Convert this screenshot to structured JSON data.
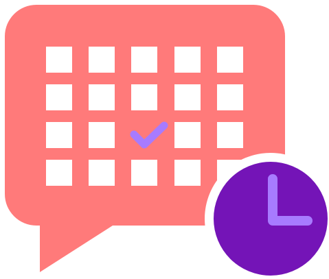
{
  "icon": {
    "name": "calendar-schedule-icon",
    "rows": 4,
    "columns": 5,
    "checked_cell": {
      "row": 3,
      "column": 3
    },
    "colors": {
      "bubble": "#FF7A7A",
      "cell": "#FFFFFF",
      "check": "#A77BFF",
      "clock_face": "#7414B7",
      "clock_ring": "#FFFFFF",
      "clock_hands": "#A77BFF"
    }
  }
}
